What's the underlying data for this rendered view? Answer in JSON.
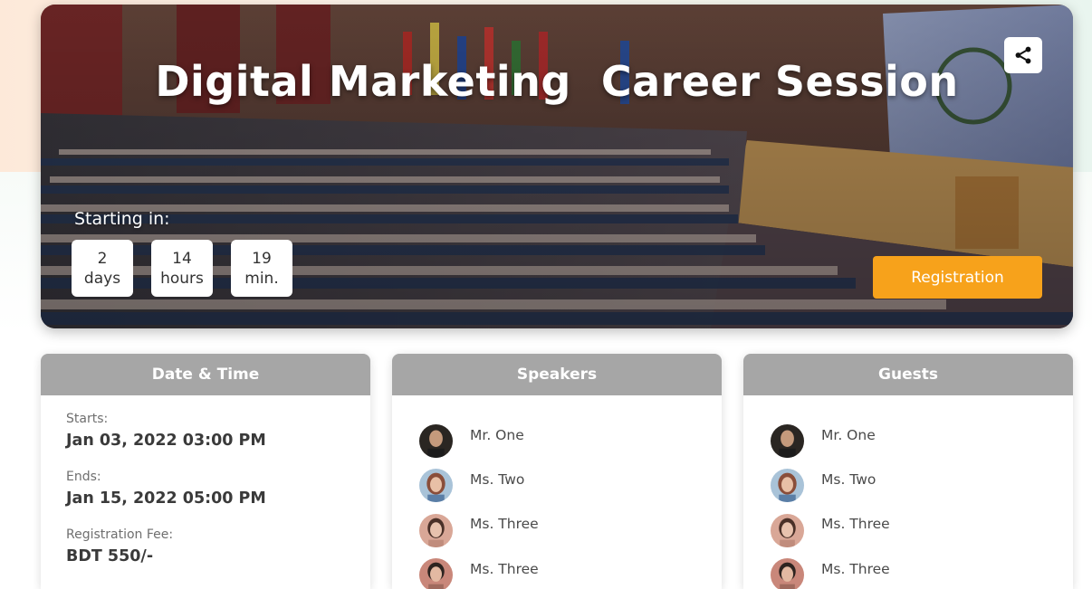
{
  "hero": {
    "title": "Digital Marketing  Career Session",
    "starting_label": "Starting in:",
    "countdown": [
      {
        "value": "2",
        "unit": "days"
      },
      {
        "value": "14",
        "unit": "hours"
      },
      {
        "value": "19",
        "unit": "min."
      }
    ],
    "registration_label": "Registration",
    "share_icon": "share-icon"
  },
  "date_time": {
    "header": "Date & Time",
    "starts_label": "Starts:",
    "starts_value": "Jan 03, 2022 03:00 PM",
    "ends_label": "Ends:",
    "ends_value": "Jan 15, 2022 05:00 PM",
    "fee_label": "Registration Fee:",
    "fee_value": "BDT 550/-"
  },
  "speakers": {
    "header": "Speakers",
    "people": [
      {
        "name": "Mr. One"
      },
      {
        "name": "Ms. Two"
      },
      {
        "name": "Ms. Three"
      },
      {
        "name": "Ms. Three"
      }
    ]
  },
  "guests": {
    "header": "Guests",
    "people": [
      {
        "name": "Mr. One"
      },
      {
        "name": "Ms. Two"
      },
      {
        "name": "Ms. Three"
      },
      {
        "name": "Ms. Three"
      }
    ]
  },
  "colors": {
    "accent": "#f7a21b",
    "card_header": "#a6a6a6"
  }
}
